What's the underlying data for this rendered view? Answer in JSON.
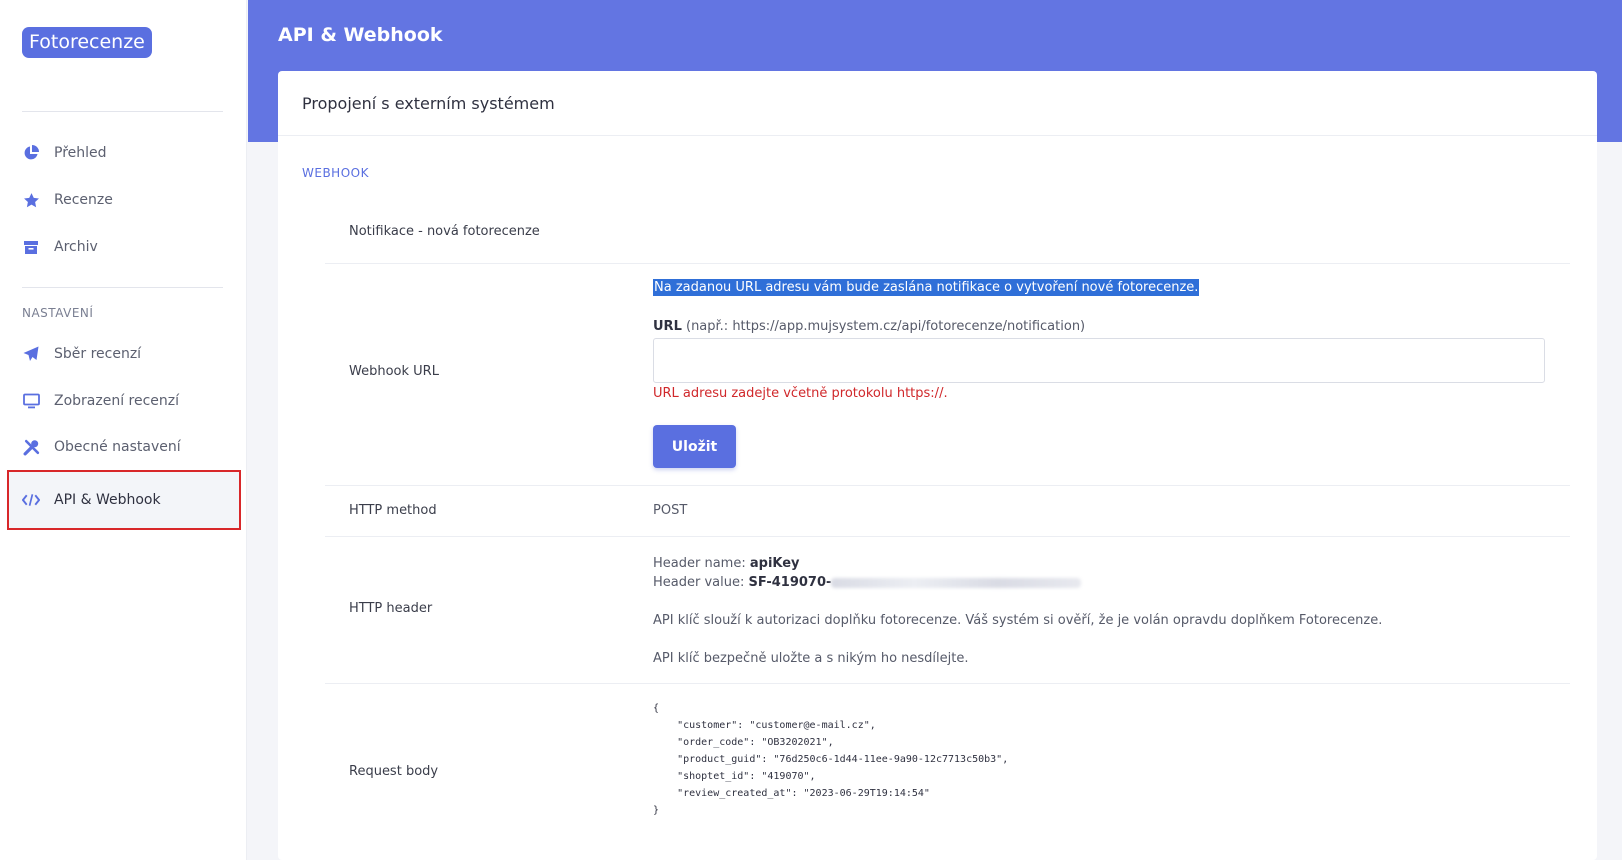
{
  "app": {
    "logo_text": "Fotorecenze"
  },
  "sidebar": {
    "items_top": [
      {
        "label": "Přehled",
        "icon": "pie-chart-icon"
      },
      {
        "label": "Recenze",
        "icon": "star-icon"
      },
      {
        "label": "Archiv",
        "icon": "archive-icon"
      }
    ],
    "section_title": "NASTAVENÍ",
    "items_settings": [
      {
        "label": "Sběr recenzí",
        "icon": "paper-plane-icon"
      },
      {
        "label": "Zobrazení recenzí",
        "icon": "monitor-icon"
      },
      {
        "label": "Obecné nastavení",
        "icon": "tools-icon"
      },
      {
        "label": "API & Webhook",
        "icon": "code-icon"
      }
    ]
  },
  "header": {
    "title": "API & Webhook"
  },
  "card": {
    "title": "Propojení s externím systémem",
    "section_label": "WEBHOOK",
    "notification_row": {
      "label": "Notifikace - nová fotorecenze"
    },
    "webhook_row": {
      "label": "Webhook URL",
      "description": "Na zadanou URL adresu vám bude zaslána notifikace o vytvoření nové fotorecenze.",
      "url_label": "URL",
      "url_example": " (např.: https://app.mujsystem.cz/api/fotorecenze/notification)",
      "url_value": "",
      "hint": "URL adresu zadejte včetně protokolu https://.",
      "save_label": "Uložit"
    },
    "method_row": {
      "label": "HTTP method",
      "value": "POST"
    },
    "header_row": {
      "label": "HTTP header",
      "name_prefix": "Header name: ",
      "name_value": "apiKey",
      "value_prefix": "Header value: ",
      "value_value": "SF-419070-",
      "note1": "API klíč slouží k autorizaci doplňku fotorecenze. Váš systém si ověří, že je volán opravdu doplňkem Fotorecenze.",
      "note2": "API klíč bezpečně uložte a s nikým ho nesdílejte."
    },
    "body_row": {
      "label": "Request body",
      "code": "{\n    \"customer\": \"customer@e-mail.cz\",\n    \"order_code\": \"OB3202021\",\n    \"product_guid\": \"76d250c6-1d44-11ee-9a90-12c7713c50b3\",\n    \"shoptet_id\": \"419070\",\n    \"review_created_at\": \"2023-06-29T19:14:54\"\n}"
    }
  },
  "colors": {
    "accent": "#6375e2",
    "button": "#5a6fe0",
    "error": "#d0282b",
    "active_outline": "#d8272a"
  }
}
